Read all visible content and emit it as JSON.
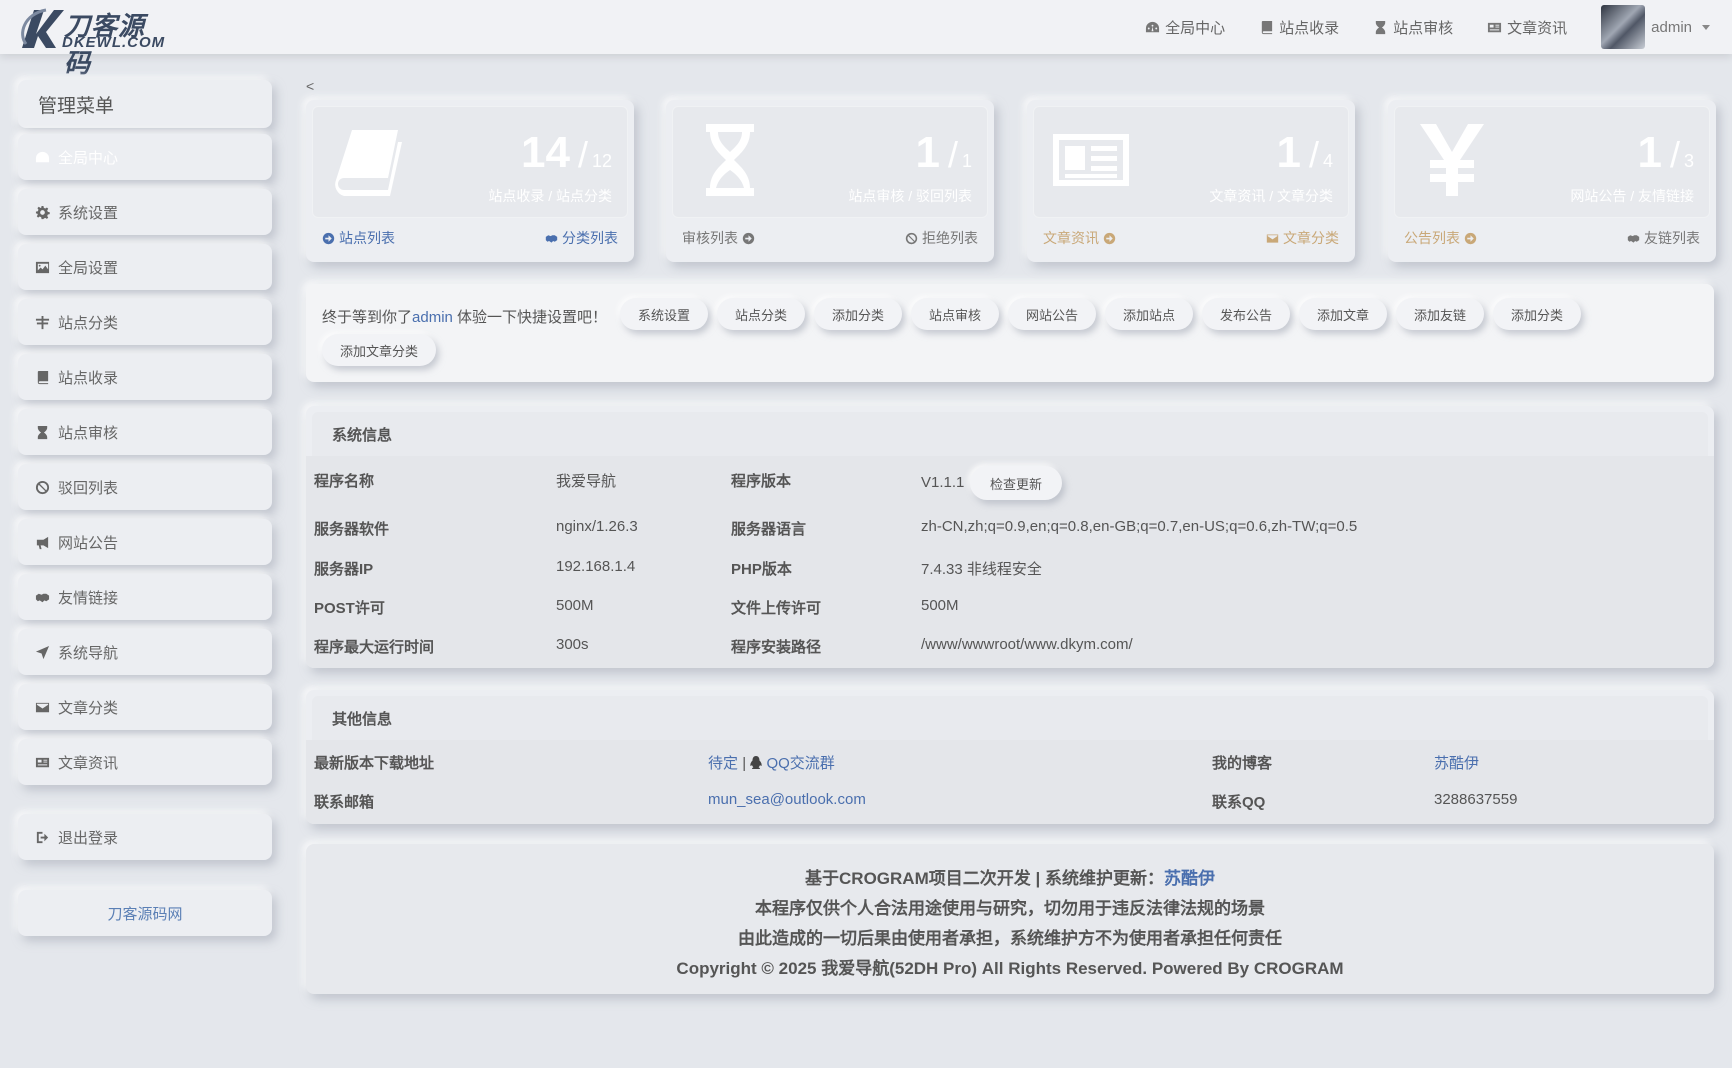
{
  "logo": {
    "cn": "刀客源码",
    "en": "DKEWL.COM"
  },
  "topnav": [
    {
      "label": "全局中心",
      "icon": "dashboard-icon"
    },
    {
      "label": "站点收录",
      "icon": "book-icon"
    },
    {
      "label": "站点审核",
      "icon": "hourglass-icon"
    },
    {
      "label": "文章资讯",
      "icon": "newspaper-icon"
    }
  ],
  "user": {
    "name": "admin"
  },
  "sidebar": {
    "title": "管理菜单",
    "items": [
      {
        "label": "全局中心",
        "icon": "dashboard-icon",
        "active": true
      },
      {
        "label": "系统设置",
        "icon": "gear-icon"
      },
      {
        "label": "全局设置",
        "icon": "image-icon"
      },
      {
        "label": "站点分类",
        "icon": "category-icon"
      },
      {
        "label": "站点收录",
        "icon": "book-icon"
      },
      {
        "label": "站点审核",
        "icon": "hourglass-icon"
      },
      {
        "label": "驳回列表",
        "icon": "ban-icon"
      },
      {
        "label": "网站公告",
        "icon": "bullhorn-icon"
      },
      {
        "label": "友情链接",
        "icon": "handshake-icon"
      },
      {
        "label": "系统导航",
        "icon": "location-arrow-icon"
      },
      {
        "label": "文章分类",
        "icon": "envelope-icon"
      },
      {
        "label": "文章资讯",
        "icon": "newspaper-icon"
      }
    ],
    "logout": "退出登录",
    "footer_link": "刀客源码网"
  },
  "collapse": "<",
  "stats": [
    {
      "icon": "book-icon",
      "big": "14",
      "small": "12",
      "caption": "站点收录 / 站点分类",
      "link_left": "站点列表",
      "link_right": "分类列表"
    },
    {
      "icon": "hourglass-icon",
      "big": "1",
      "small": "1",
      "caption": "站点审核 / 驳回列表",
      "link_left": "审核列表",
      "link_right": "拒绝列表"
    },
    {
      "icon": "newspaper-icon",
      "big": "1",
      "small": "4",
      "caption": "文章资讯 / 文章分类",
      "link_left": "文章资讯",
      "link_right": "文章分类"
    },
    {
      "icon": "yen-icon",
      "big": "1",
      "small": "3",
      "caption": "网站公告 / 友情链接",
      "link_left": "公告列表",
      "link_right": "友链列表"
    }
  ],
  "quick": {
    "greet_before": "终于等到你了",
    "greet_user": "admin",
    "greet_after": " 体验一下快捷设置吧！",
    "buttons": [
      "系统设置",
      "站点分类",
      "添加分类",
      "站点审核",
      "网站公告",
      "添加站点",
      "发布公告",
      "添加文章",
      "添加友链",
      "添加分类",
      "添加文章分类"
    ]
  },
  "sysinfo": {
    "title": "系统信息",
    "rows": [
      {
        "l1": "程序名称",
        "v1": "我爱导航",
        "l2": "程序版本",
        "v2": "V1.1.1"
      },
      {
        "l1": "服务器软件",
        "v1": "nginx/1.26.3",
        "l2": "服务器语言",
        "v2": "zh-CN,zh;q=0.9,en;q=0.8,en-GB;q=0.7,en-US;q=0.6,zh-TW;q=0.5"
      },
      {
        "l1": "服务器IP",
        "v1": "192.168.1.4",
        "l2": "PHP版本",
        "v2": "7.4.33 非线程安全"
      },
      {
        "l1": "POST许可",
        "v1": "500M",
        "l2": "文件上传许可",
        "v2": "500M"
      },
      {
        "l1": "程序最大运行时间",
        "v1": "300s",
        "l2": "程序安装路径",
        "v2": "/www/wwwroot/www.dkym.com/"
      }
    ],
    "check_update": "检查更新"
  },
  "other": {
    "title": "其他信息",
    "download_label": "最新版本下载地址",
    "download_pending": "待定",
    "separator": "|",
    "qq_group": "QQ交流群",
    "blog_label": "我的博客",
    "blog_value": "苏酷伊",
    "email_label": "联系邮箱",
    "email_value": "mun_sea@outlook.com",
    "qq_label": "联系QQ",
    "qq_value": "3288637559"
  },
  "footer": {
    "line1_prefix": "基于CROGRAM项目二次开发 | 系统维护更新：",
    "line1_link": "苏酷伊",
    "line2": "本程序仅供个人合法用途使用与研究，切勿用于违反法律法规的场景",
    "line3": "由此造成的一切后果由使用者承担，系统维护方不为使用者承担任何责任",
    "line4": "Copyright © 2025 我爱导航(52DH Pro) All Rights Reserved. Powered By CROGRAM"
  }
}
